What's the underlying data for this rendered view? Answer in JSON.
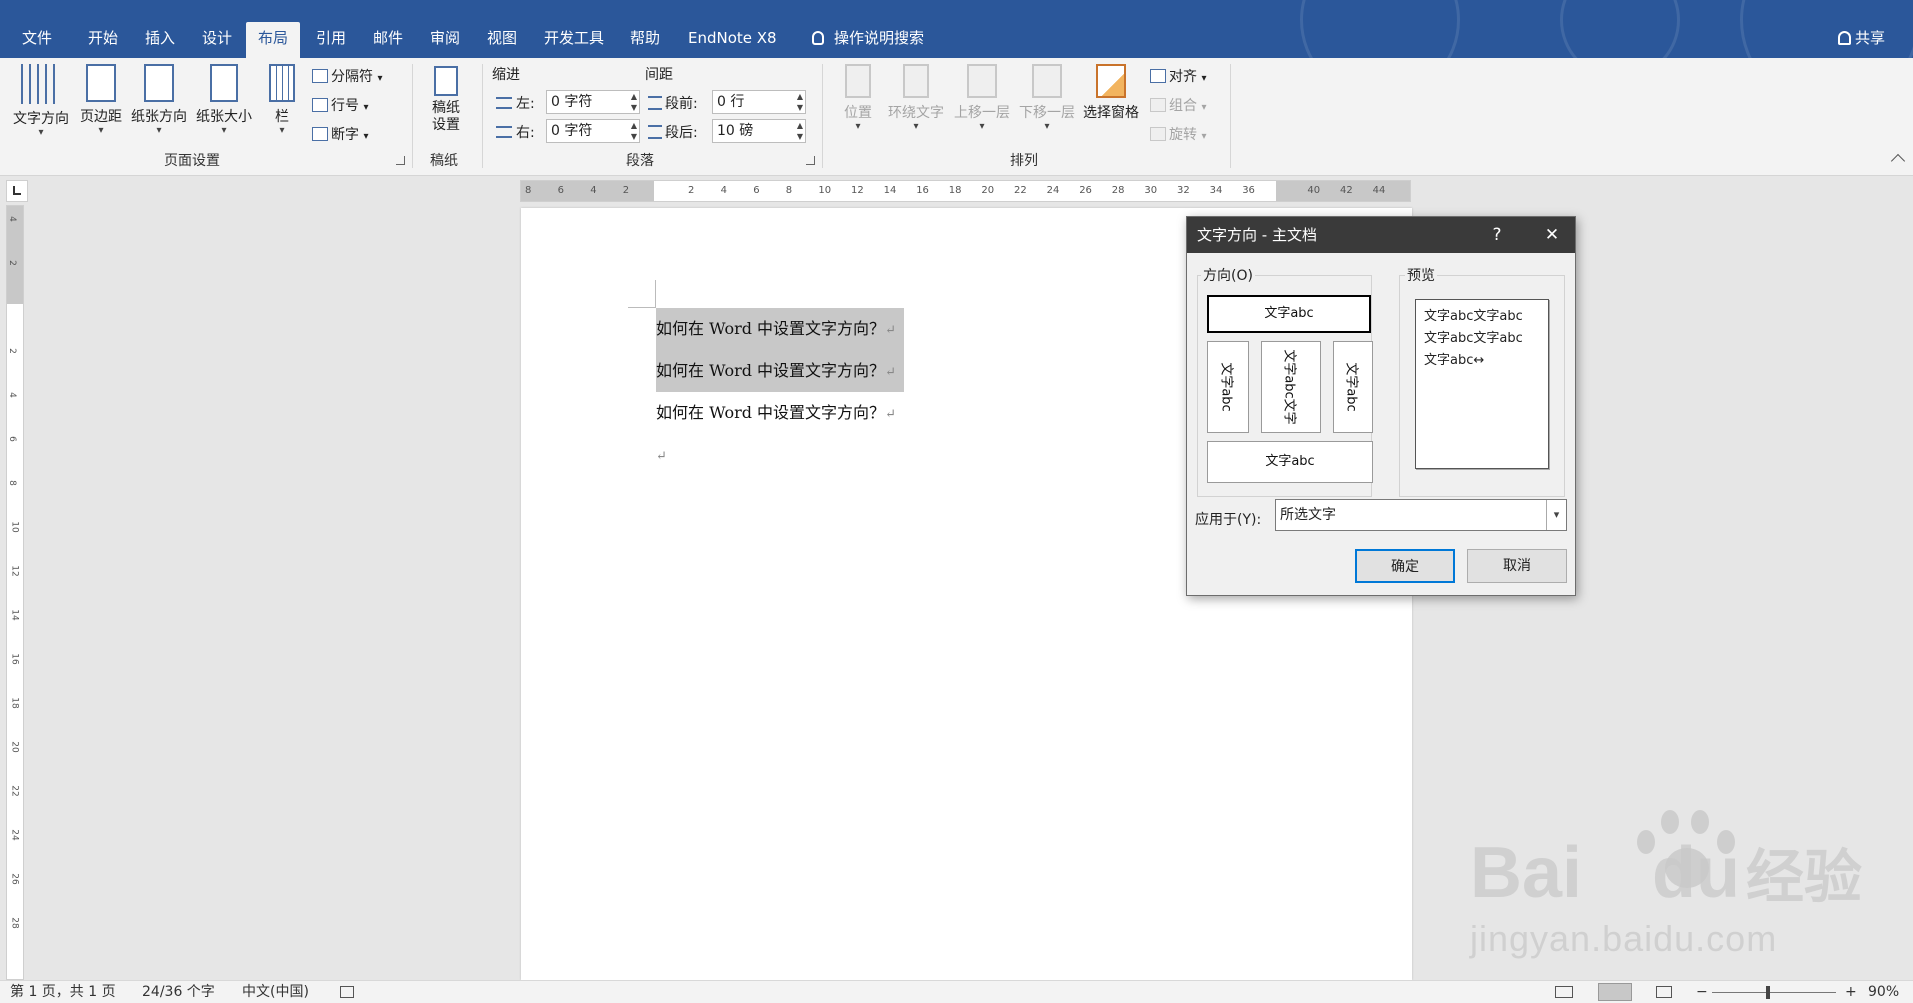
{
  "tabs": [
    "文件",
    "开始",
    "插入",
    "设计",
    "布局",
    "引用",
    "邮件",
    "审阅",
    "视图",
    "开发工具",
    "帮助",
    "EndNote X8"
  ],
  "active_tab": "布局",
  "tell_me": "操作说明搜索",
  "share": "共享",
  "ribbon": {
    "page_setup": {
      "text_direction": "文字方向",
      "margins": "页边距",
      "orientation": "纸张方向",
      "size": "纸张大小",
      "columns": "栏",
      "breaks": "分隔符",
      "line_numbers": "行号",
      "hyphenation": "断字",
      "label": "页面设置"
    },
    "manuscript": {
      "button": "稿纸设置",
      "button_line1": "稿纸",
      "button_line2": "设置",
      "label": "稿纸"
    },
    "paragraph": {
      "indent_label": "缩进",
      "spacing_label": "间距",
      "left_label": "左:",
      "left_value": "0 字符",
      "right_label": "右:",
      "right_value": "0 字符",
      "before_label": "段前:",
      "before_value": "0 行",
      "after_label": "段后:",
      "after_value": "10 磅",
      "label": "段落"
    },
    "arrange": {
      "position": "位置",
      "wrap": "环绕文字",
      "forward": "上移一层",
      "backward": "下移一层",
      "selection_pane": "选择窗格",
      "align": "对齐",
      "group": "组合",
      "rotate": "旋转",
      "label": "排列"
    }
  },
  "ruler_ticks": [
    "8",
    "6",
    "4",
    "2",
    "",
    "2",
    "4",
    "6",
    "8",
    "10",
    "12",
    "14",
    "16",
    "18",
    "20",
    "22",
    "24",
    "26",
    "28",
    "30",
    "32",
    "34",
    "36",
    "",
    "40",
    "42",
    "44"
  ],
  "vruler_ticks": [
    "4",
    "2",
    "",
    "2",
    "4",
    "6",
    "8",
    "10",
    "12",
    "14",
    "16",
    "18",
    "20",
    "22",
    "24",
    "26",
    "28"
  ],
  "document": {
    "lines": [
      "如何在 Word 中设置文字方向？",
      "如何在 Word 中设置文字方向？",
      "如何在 Word 中设置文字方向？"
    ],
    "para_mark": "↵"
  },
  "dialog": {
    "title": "文字方向 - 主文档",
    "help": "?",
    "close": "✕",
    "direction_label": "方向(O)",
    "preview_label": "预览",
    "options": {
      "horizontal": "文字abc",
      "vertical_left": "文字abc",
      "vertical_stacked": "文字abc文字",
      "vertical_right": "文字abc",
      "horizontal_flipped": "文字abc"
    },
    "preview_lines": [
      "文字abc文字abc",
      "文字abc文字abc",
      "文字abc↔"
    ],
    "apply_label": "应用于(Y):",
    "apply_value": "所选文字",
    "ok": "确定",
    "cancel": "取消"
  },
  "status": {
    "page": "第 1 页，共 1 页",
    "words": "24/36 个字",
    "language": "中文(中国)",
    "zoom": "90%",
    "zoom_minus": "−",
    "zoom_plus": "+"
  },
  "watermark": {
    "brand": "Bai",
    "brand2": "du",
    "cn": "经验",
    "url": "jingyan.baidu.com"
  },
  "colors": {
    "title_bar": "#2b579a",
    "dialog_title": "#3a3a3a",
    "selection": "#c8c8c8",
    "ok_border": "#0078d7"
  }
}
